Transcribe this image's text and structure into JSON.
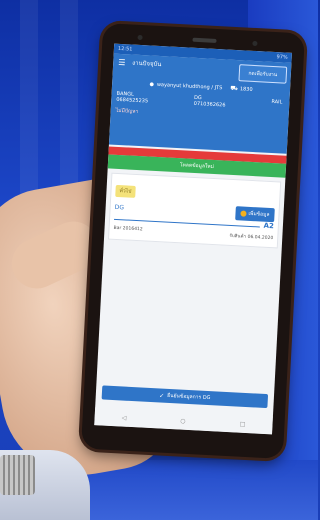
{
  "status_bar": {
    "time": "12:51",
    "battery": "97%"
  },
  "header": {
    "app_title": "งานปัจจุบัน",
    "top_button_label": "กดเพื่อรับงาน",
    "user_text": "wayanyut khudthong / JTS",
    "truck_number": "1830",
    "col1": {
      "label": "BANGL",
      "value": "0684525235"
    },
    "col2": {
      "label": "DG",
      "value": "0710362626"
    },
    "col3": {
      "label": "RAIL"
    },
    "status_text": "ไม่มีปัญหา"
  },
  "green_bar_label": "โหลดข้อมูลใหม่",
  "card": {
    "tag": "ทั่วไป",
    "dg_label": "DG",
    "action_button": "เพิ่มข้อมูล",
    "a2": "A2",
    "left_detail": "Bar 2016412",
    "right_detail": "รับสินค้า 06.04.2020"
  },
  "bottom_button": "ยืนยันข้อมูลการ DG",
  "colors": {
    "primary": "#2f75c8",
    "danger": "#e53a3a",
    "success": "#39b45a",
    "tag": "#f4e27a"
  }
}
